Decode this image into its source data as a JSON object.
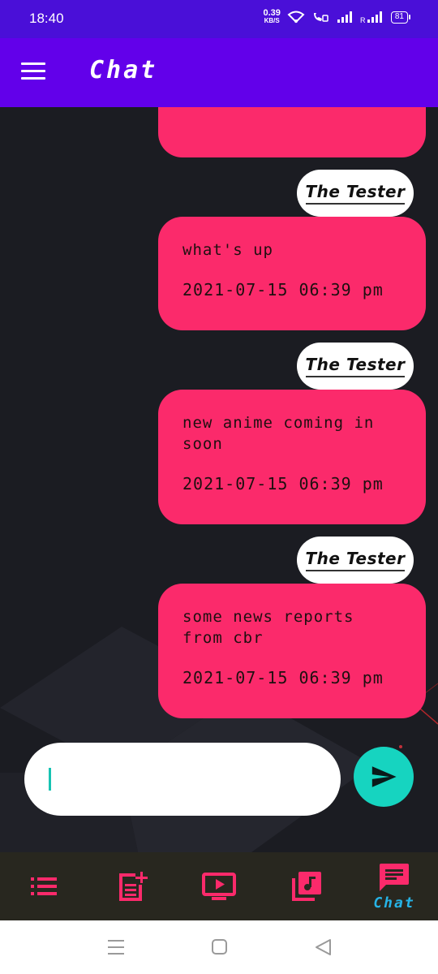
{
  "status_bar": {
    "time": "18:40",
    "net_speed_value": "0.39",
    "net_speed_unit": "KB/S",
    "battery": "81"
  },
  "app_bar": {
    "title": "Chat",
    "menu_icon": "hamburger-menu-icon"
  },
  "messages": [
    {
      "sender": "The Tester",
      "text": "what's up",
      "time": "2021-07-15 06:39 pm"
    },
    {
      "sender": "The Tester",
      "text": "new anime coming in soon",
      "time": "2021-07-15 06:39 pm"
    },
    {
      "sender": "The Tester",
      "text": "some news reports from cbr",
      "time": "2021-07-15 06:39 pm"
    }
  ],
  "input": {
    "value": "",
    "placeholder": ""
  },
  "bottom_nav": {
    "items": [
      {
        "icon": "list-icon",
        "label": ""
      },
      {
        "icon": "post-add-icon",
        "label": ""
      },
      {
        "icon": "video-icon",
        "label": ""
      },
      {
        "icon": "music-library-icon",
        "label": ""
      },
      {
        "icon": "chat-icon",
        "label": "Chat",
        "active": true
      }
    ]
  },
  "colors": {
    "status_bar": "#4a0fd8",
    "app_bar": "#6200ea",
    "bubble": "#fb2a6b",
    "send_button": "#16d4c0",
    "nav_icon": "#fb2a6b",
    "nav_active_label": "#26b3e6"
  }
}
